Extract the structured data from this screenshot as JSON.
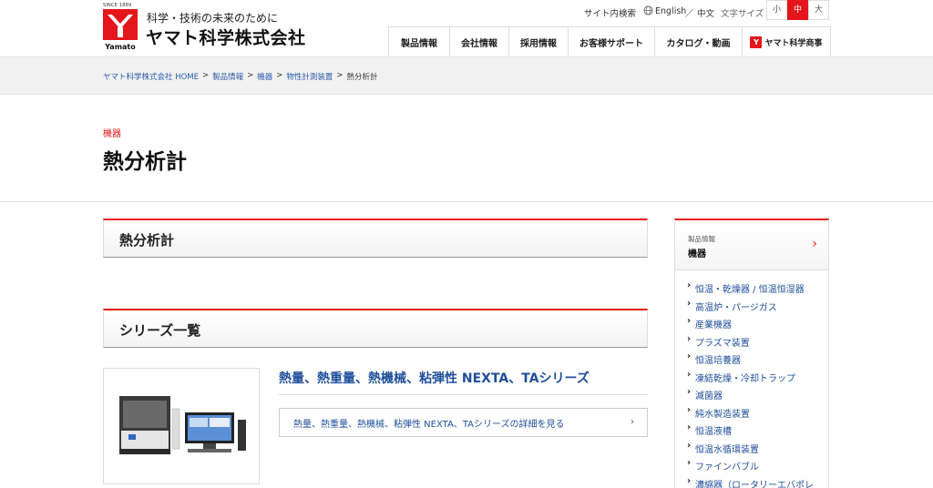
{
  "header": {
    "since": "SINCE 1889",
    "tagline": "科学・技術の未来のために",
    "company": "ヤマト科学株式会社",
    "logo_word": "Yamato",
    "util": {
      "site_search": "サイト内検索",
      "english": "English",
      "sep": "／",
      "chinese": "中文",
      "font_size_label": "文字サイズ"
    },
    "font_sizes": [
      "小",
      "中",
      "大"
    ],
    "nav": [
      "製品情報",
      "会社情報",
      "採用情報",
      "お客様サポート",
      "カタログ・動画"
    ],
    "shop_label": "ヤマト科学商事",
    "accent": "#e4161b"
  },
  "breadcrumb": [
    {
      "label": "ヤマト科学株式会社 HOME",
      "link": true
    },
    {
      "label": "製品情報",
      "link": true
    },
    {
      "label": "機器",
      "link": true
    },
    {
      "label": "物性計測装置",
      "link": true
    },
    {
      "label": "熱分析計",
      "link": false
    }
  ],
  "breadcrumb_sep": ">",
  "page": {
    "category": "機器",
    "title": "熱分析計"
  },
  "sections": {
    "first": "熱分析計",
    "series": "シリーズ一覧"
  },
  "product": {
    "title": "熱量、熱重量、熱機械、粘弾性 NEXTA、TAシリーズ",
    "link_label": "熱量、熱重量、熱機械、粘弾性 NEXTA、TAシリーズの詳細を見る",
    "link_chevron": "›"
  },
  "sidebar": {
    "sub": "製品情報",
    "title": "機器",
    "chevron": "›",
    "items": [
      "恒温・乾燥器 / 恒温恒湿器",
      "高温炉・パージガス",
      "産業機器",
      "プラズマ装置",
      "恒温培養器",
      "凍結乾燥・冷却トラップ",
      "滅菌器",
      "純水製造装置",
      "恒温液槽",
      "恒温水循環装置",
      "ファインバブル",
      "濃縮器（ロータリーエバポレ"
    ]
  }
}
